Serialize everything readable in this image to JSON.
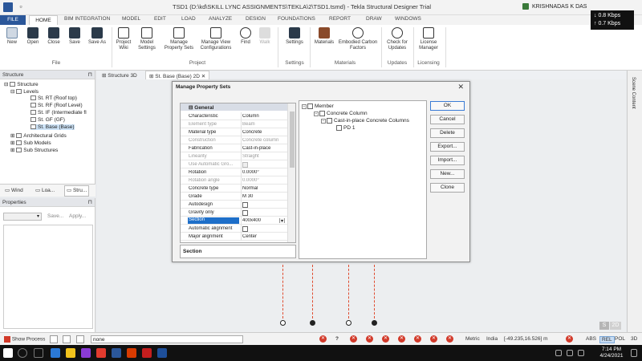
{
  "window": {
    "title": "TSD1 (D:\\kd\\SKILL LYNC ASSIGNMENTS\\TEKLA\\2\\TSD1.tsmd) - Tekla Structural Designer Trial",
    "user": "KRISHNADAS K DAS"
  },
  "network": {
    "down": "0.8 Kbps",
    "up": "0.7 Kbps"
  },
  "menu": {
    "tabs": [
      "FILE",
      "HOME",
      "BIM INTEGRATION",
      "MODEL",
      "EDIT",
      "LOAD",
      "ANALYZE",
      "DESIGN",
      "FOUNDATIONS",
      "REPORT",
      "DRAW",
      "WINDOWS"
    ]
  },
  "ribbon": {
    "file": {
      "new": "New",
      "open": "Open",
      "close": "Close",
      "save": "Save",
      "save_as": "Save As",
      "group": "File"
    },
    "project": {
      "wiki": "Project Wiki",
      "model_settings": "Model Settings",
      "property_sets": "Manage Property Sets",
      "view_configs": "Manage View Configurations",
      "find": "Find",
      "walk": "Walk",
      "group": "Project"
    },
    "settings": {
      "settings": "Settings",
      "group": "Settings"
    },
    "materials": {
      "materials": "Materials",
      "embodied": "Embodied Carbon Factors",
      "group": "Materials"
    },
    "updates": {
      "check": "Check for Updates",
      "group": "Updates"
    },
    "licensing": {
      "license": "License Manager",
      "group": "Licensing"
    }
  },
  "structure_panel": {
    "title": "Structure",
    "tree": {
      "root": "Structure",
      "levels": "Levels",
      "level_items": [
        "St. RT (Roof top)",
        "St. RF (Roof Level)",
        "St. IF (Intermediate fl",
        "St. GF (GF)",
        "St. Base (Base)"
      ],
      "grids": "Architectural Grids",
      "sub_models": "Sub Models",
      "sub_structures": "Sub Structures"
    },
    "tabs": [
      "Wind",
      "Loa...",
      "Stru..."
    ]
  },
  "properties_panel": {
    "title": "Properties",
    "save": "Save...",
    "apply": "Apply..."
  },
  "view_tabs": [
    "Structure 3D",
    "St. Base (Base) 2D"
  ],
  "scene_content": "Scene Content",
  "dialog": {
    "title": "Manage Property Sets",
    "group_header": "General",
    "rows": [
      {
        "key": "Characteristic",
        "value": "Column"
      },
      {
        "key": "Element type",
        "value": "Beam",
        "dim": true
      },
      {
        "key": "Material type",
        "value": "Concrete"
      },
      {
        "key": "Construction",
        "value": "Concrete column",
        "dim": true
      },
      {
        "key": "Fabrication",
        "value": "Cast-in-place"
      },
      {
        "key": "Linearity",
        "value": "Straight",
        "dim": true
      },
      {
        "key": "Use Automatic Gro...",
        "value": "",
        "dim": true,
        "check": true
      },
      {
        "key": "Rotation",
        "value": "0.0000°"
      },
      {
        "key": "Rotation angle",
        "value": "0.0000°",
        "dim": true
      },
      {
        "key": "Concrete type",
        "value": "Normal"
      },
      {
        "key": "Grade",
        "value": "M 30"
      },
      {
        "key": "Autodesign",
        "value": "",
        "check": true
      },
      {
        "key": "Gravity only",
        "value": "",
        "check": true
      },
      {
        "key": "Section",
        "value": "400x400",
        "selected": true
      },
      {
        "key": "Automatic alignment",
        "value": "",
        "check": true
      },
      {
        "key": "Major alignment",
        "value": "Center"
      }
    ],
    "description": "Section",
    "tree": {
      "member": "Member",
      "concrete_column": "Concrete Column",
      "cast_in_place": "Cast-in-place Concrete Columns",
      "pd1": "PD 1"
    },
    "buttons": [
      "OK",
      "Cancel",
      "Delete",
      "Export...",
      "Import...",
      "New...",
      "Clone"
    ]
  },
  "status": {
    "show_process": "Show Process",
    "command": "none",
    "units": "Metric",
    "region": "India",
    "coords": "[-49.235,16.526] m",
    "modes": [
      "ABS",
      "REL",
      "POL",
      "3D"
    ],
    "active_mode": "REL"
  },
  "view_badges": {
    "s": "S",
    "d": "2D"
  },
  "clock": {
    "time": "7:14 PM",
    "date": "4/24/2021"
  },
  "colors": {
    "file_tab": "#2b579a",
    "selection": "#1e6fc9",
    "grid_line": "#e04c2f"
  }
}
